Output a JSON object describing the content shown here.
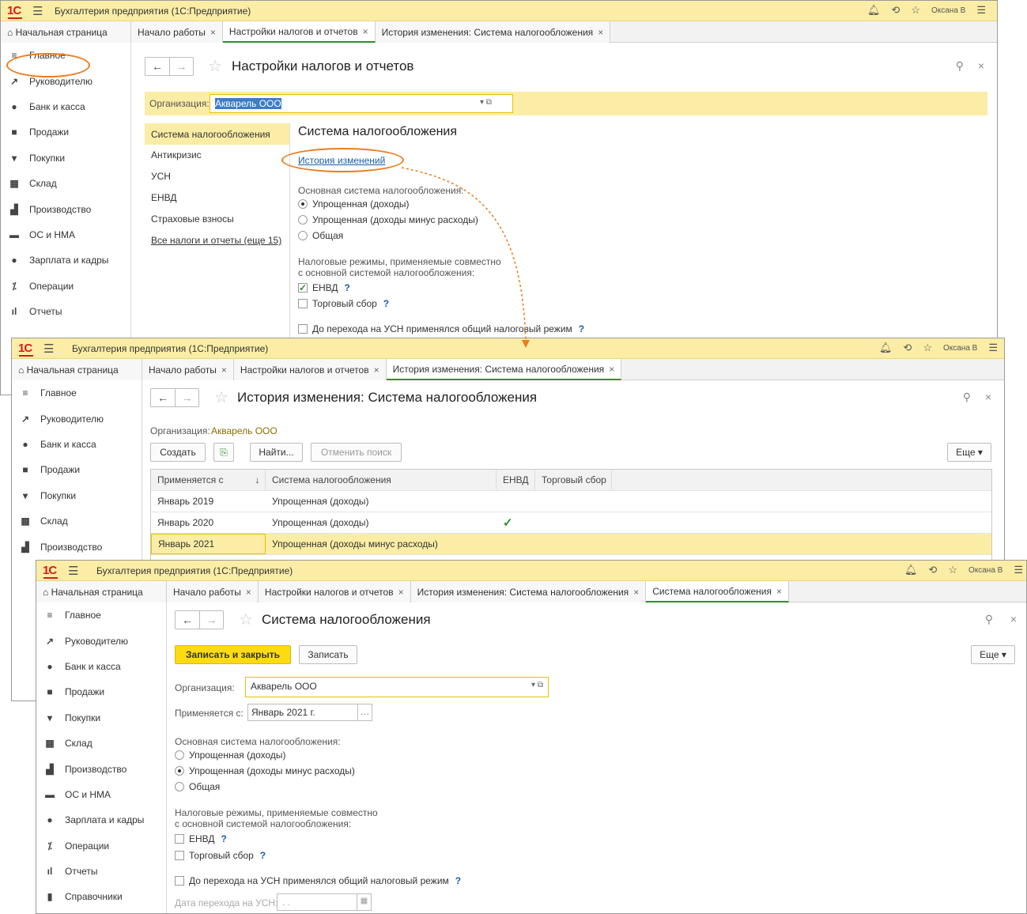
{
  "app": {
    "title": "Бухгалтерия предприятия  (1С:Предприятие)",
    "user": "Оксана В"
  },
  "tabs": {
    "home": "Начальная страница",
    "start": "Начало работы",
    "settings": "Настройки налогов и отчетов",
    "history": "История изменения: Система налогообложения",
    "system": "Система налогообложения"
  },
  "sidebar": [
    "Главное",
    "Руководителю",
    "Банк и касса",
    "Продажи",
    "Покупки",
    "Склад",
    "Производство",
    "ОС и НМА",
    "Зарплата и кадры",
    "Операции",
    "Отчеты",
    "Справочники"
  ],
  "icons": [
    "menu-icon",
    "trend-icon",
    "bank-icon",
    "bag-icon",
    "cart-icon",
    "warehouse-icon",
    "factory-icon",
    "truck-icon",
    "person-icon",
    "operations-icon",
    "chart-icon",
    "book-icon"
  ],
  "w1": {
    "title": "Настройки налогов и отчетов",
    "org_label": "Организация:",
    "org_value": "Акварель ООО",
    "nav": [
      "Система налогообложения",
      "Антикризис",
      "УСН",
      "ЕНВД",
      "Страховые взносы",
      "Все налоги и отчеты (еще 15)"
    ],
    "section_title": "Система налогообложения",
    "history_link": "История изменений",
    "base_label": "Основная система налогообложения:",
    "radios": [
      "Упрощенная (доходы)",
      "Упрощенная (доходы минус расходы)",
      "Общая"
    ],
    "modes_label1": "Налоговые режимы, применяемые совместно",
    "modes_label2": "с основной системой налогообложения:",
    "envd": "ЕНВД",
    "trade": "Торговый сбор",
    "usn_transition": "До перехода на УСН применялся общий налоговый режим",
    "q": "?"
  },
  "w2": {
    "title": "История изменения: Система налогообложения",
    "org_label": "Организация:",
    "org_value": "Акварель ООО",
    "btn_create": "Создать",
    "btn_find": "Найти...",
    "btn_cancel": "Отменить поиск",
    "btn_more": "Еще",
    "columns": [
      "Применяется с",
      "Система налогообложения",
      "ЕНВД",
      "Торговый сбор"
    ],
    "rows": [
      {
        "date": "Январь 2019",
        "system": "Упрощенная (доходы)",
        "envd": ""
      },
      {
        "date": "Январь 2020",
        "system": "Упрощенная (доходы)",
        "envd": "✓"
      },
      {
        "date": "Январь 2021",
        "system": "Упрощенная (доходы минус расходы)",
        "envd": ""
      }
    ]
  },
  "w3": {
    "title": "Система налогообложения",
    "btn_save_close": "Записать и закрыть",
    "btn_save": "Записать",
    "btn_more": "Еще",
    "org_label": "Организация:",
    "org_value": "Акварель ООО",
    "applies_label": "Применяется с:",
    "applies_value": "Январь 2021 г.",
    "base_label": "Основная система налогообложения:",
    "radios": [
      "Упрощенная (доходы)",
      "Упрощенная (доходы минус расходы)",
      "Общая"
    ],
    "modes_label1": "Налоговые режимы, применяемые совместно",
    "modes_label2": "с основной системой налогообложения:",
    "envd": "ЕНВД",
    "trade": "Торговый сбор",
    "usn_transition": "До перехода на УСН применялся общий налоговый режим",
    "transition_date_label": "Дата перехода на УСН:",
    "transition_date_value": " .  .",
    "q": "?"
  },
  "colors": {
    "accent_yellow": "#fcdb13",
    "header_bg": "#fbeda5",
    "highlight": "#e87c1e",
    "link": "#1a5ea8",
    "check": "#2d8f2d"
  }
}
